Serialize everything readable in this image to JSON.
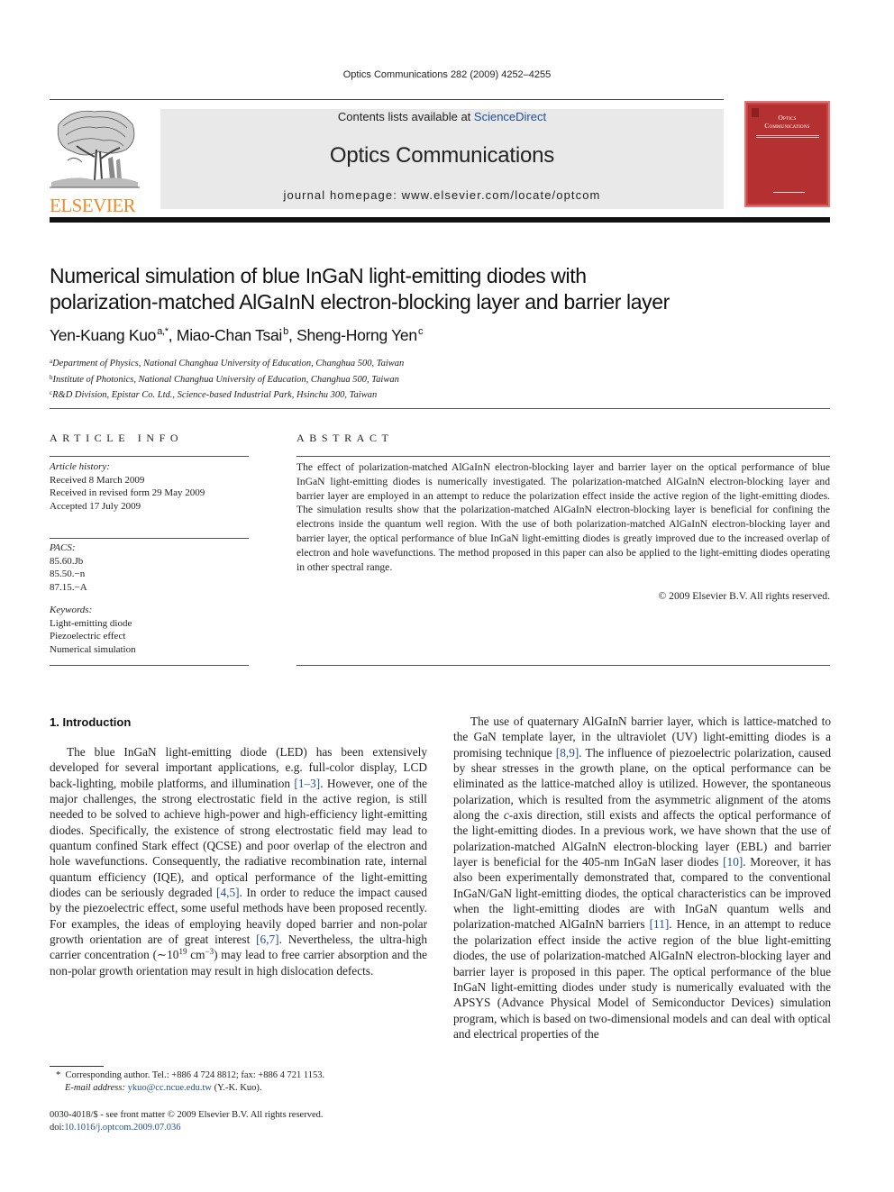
{
  "running_head": "Optics Communications 282 (2009) 4252–4255",
  "publisher": {
    "name": "ELSEVIER",
    "logo_icon": "elsevier-tree-icon",
    "brand_color": "#f08a24"
  },
  "masthead": {
    "contents_prefix": "Contents lists available at ",
    "contents_link": "ScienceDirect",
    "journal_title": "Optics Communications",
    "homepage": "journal homepage: www.elsevier.com/locate/optcom",
    "link_color": "#1f4e99",
    "background_color": "#e9e9e9"
  },
  "cover": {
    "title_line1": "Optics",
    "title_line2": "Communications",
    "color": "#b53131"
  },
  "article": {
    "title_line1": "Numerical simulation of blue InGaN light-emitting diodes with",
    "title_line2": "polarization-matched AlGaInN electron-blocking layer and barrier layer",
    "authors": [
      {
        "name": "Yen-Kuang Kuo",
        "marks": "a,*"
      },
      {
        "name": "Miao-Chan Tsai",
        "marks": "b"
      },
      {
        "name": "Sheng-Horng Yen",
        "marks": "c"
      }
    ],
    "affiliations": [
      {
        "mark": "a",
        "text": "Department of Physics, National Changhua University of Education, Changhua 500, Taiwan"
      },
      {
        "mark": "b",
        "text": "Institute of Photonics, National Changhua University of Education, Changhua 500, Taiwan"
      },
      {
        "mark": "c",
        "text": "R&D Division, Epistar Co. Ltd., Science-based Industrial Park, Hsinchu 300, Taiwan"
      }
    ]
  },
  "article_info": {
    "heading": "ARTICLE INFO",
    "history_label": "Article history:",
    "history": [
      "Received 8 March 2009",
      "Received in revised form 29 May 2009",
      "Accepted 17 July 2009"
    ],
    "pacs_label": "PACS:",
    "pacs": [
      "85.60.Jb",
      "85.50.−n",
      "87.15.−A"
    ],
    "keywords_label": "Keywords:",
    "keywords": [
      "Light-emitting diode",
      "Piezoelectric effect",
      "Numerical simulation"
    ]
  },
  "abstract": {
    "heading": "ABSTRACT",
    "text": "The effect of polarization-matched AlGaInN electron-blocking layer and barrier layer on the optical performance of blue InGaN light-emitting diodes is numerically investigated. The polarization-matched AlGaInN electron-blocking layer and barrier layer are employed in an attempt to reduce the polarization effect inside the active region of the light-emitting diodes. The simulation results show that the polarization-matched AlGaInN electron-blocking layer is beneficial for confining the electrons inside the quantum well region. With the use of both polarization-matched AlGaInN electron-blocking layer and barrier layer, the optical performance of blue InGaN light-emitting diodes is greatly improved due to the increased overlap of electron and hole wavefunctions. The method proposed in this paper can also be applied to the light-emitting diodes operating in other spectral range.",
    "copyright": "© 2009 Elsevier B.V. All rights reserved."
  },
  "introduction": {
    "heading": "1. Introduction",
    "left_p1": {
      "t1": "The blue InGaN light-emitting diode (LED) has been extensively developed for several important applications, e.g. full-color display, LCD back-lighting, mobile platforms, and illumination ",
      "c1": "[1–3]",
      "t2": ". However, one of the major challenges, the strong electrostatic field in the active region, is still needed to be solved to achieve high-power and high-efficiency light-emitting diodes. Specifically, the existence of strong electrostatic field may lead to quantum confined Stark effect (QCSE) and poor overlap of the electron and hole wavefunctions. Consequently, the radiative recombination rate, internal quantum efficiency (IQE), and optical performance of the light-emitting diodes can be seriously degraded ",
      "c2": "[4,5]",
      "t3": ". In order to reduce the impact caused by the piezoelectric effect, some useful methods have been proposed recently. For examples, the ideas of employing heavily doped barrier and non-polar growth orientation are of great interest ",
      "c3": "[6,7]",
      "t4": ". Nevertheless, the ultra-high carrier concentration (∼10",
      "sup1": "19",
      "t5": " cm",
      "sup2": "−3",
      "t6": ") may lead to free carrier absorption and the non-polar growth orientation may result in high dislocation defects."
    },
    "right_p1": {
      "t1": "The use of quaternary AlGaInN barrier layer, which is lattice-matched to the GaN template layer, in the ultraviolet (UV) light-emitting diodes is a promising technique ",
      "c1": "[8,9]",
      "t2": ". The influence of piezoelectric polarization, caused by shear stresses in the growth plane, on the optical performance can be eliminated as the lattice-matched alloy is utilized. However, the spontaneous polarization, which is resulted from the asymmetric alignment of the atoms along the ",
      "em1": "c",
      "t3": "-axis direction, still exists and affects the optical performance of the light-emitting diodes. In a previous work, we have shown that the use of polarization-matched AlGaInN electron-blocking layer (EBL) and barrier layer is beneficial for the 405-nm InGaN laser diodes ",
      "c2": "[10]",
      "t4": ". Moreover, it has also been experimentally demonstrated that, compared to the conventional InGaN/GaN light-emitting diodes, the optical characteristics can be improved when the light-emitting diodes are with InGaN quantum wells and polarization-matched AlGaInN barriers ",
      "c3": "[11]",
      "t5": ". Hence, in an attempt to reduce the polarization effect inside the active region of the blue light-emitting diodes, the use of polarization-matched AlGaInN electron-blocking layer and barrier layer is proposed in this paper. The optical performance of the blue InGaN light-emitting diodes under study is numerically evaluated with the APSYS (Advance Physical Model of Semiconductor Devices) simulation program, which is based on two-dimensional models and can deal with optical and electrical properties of the"
    }
  },
  "footnote": {
    "mark": "*",
    "corresponding": "Corresponding author. Tel.: +886 4 724 8812; fax: +886 4 721 1153.",
    "email_label": "E-mail address:",
    "email": "ykuo@cc.ncue.edu.tw",
    "email_suffix": " (Y.-K. Kuo)."
  },
  "front_matter": {
    "issn_line": "0030-4018/$ - see front matter © 2009 Elsevier B.V. All rights reserved.",
    "doi_label": "doi:",
    "doi": "10.1016/j.optcom.2009.07.036"
  }
}
